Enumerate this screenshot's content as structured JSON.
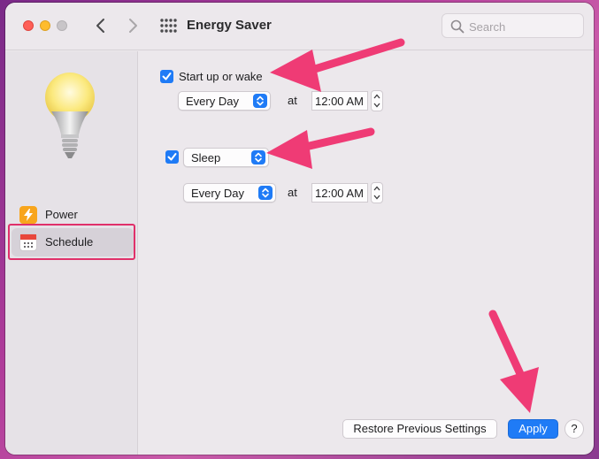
{
  "window": {
    "title": "Energy Saver"
  },
  "search": {
    "placeholder": "Search"
  },
  "sidebar": {
    "items": [
      {
        "label": "Power",
        "icon": "bolt-icon"
      },
      {
        "label": "Schedule",
        "icon": "calendar-icon",
        "selected": true
      }
    ]
  },
  "schedule": {
    "startup": {
      "label": "Start up or wake",
      "checked": true,
      "day": "Every Day",
      "at": "at",
      "time": "12:00 AM"
    },
    "sleep": {
      "checked": true,
      "mode": "Sleep",
      "day": "Every Day",
      "at": "at",
      "time": "12:00 AM"
    }
  },
  "footer": {
    "restore_label": "Restore Previous Settings",
    "apply_label": "Apply",
    "help_label": "?"
  },
  "colors": {
    "accent": "#1f7bf6",
    "annotation": "#e0306a",
    "power_icon": "#f8a51c",
    "calendar_icon": "#e8473c"
  }
}
